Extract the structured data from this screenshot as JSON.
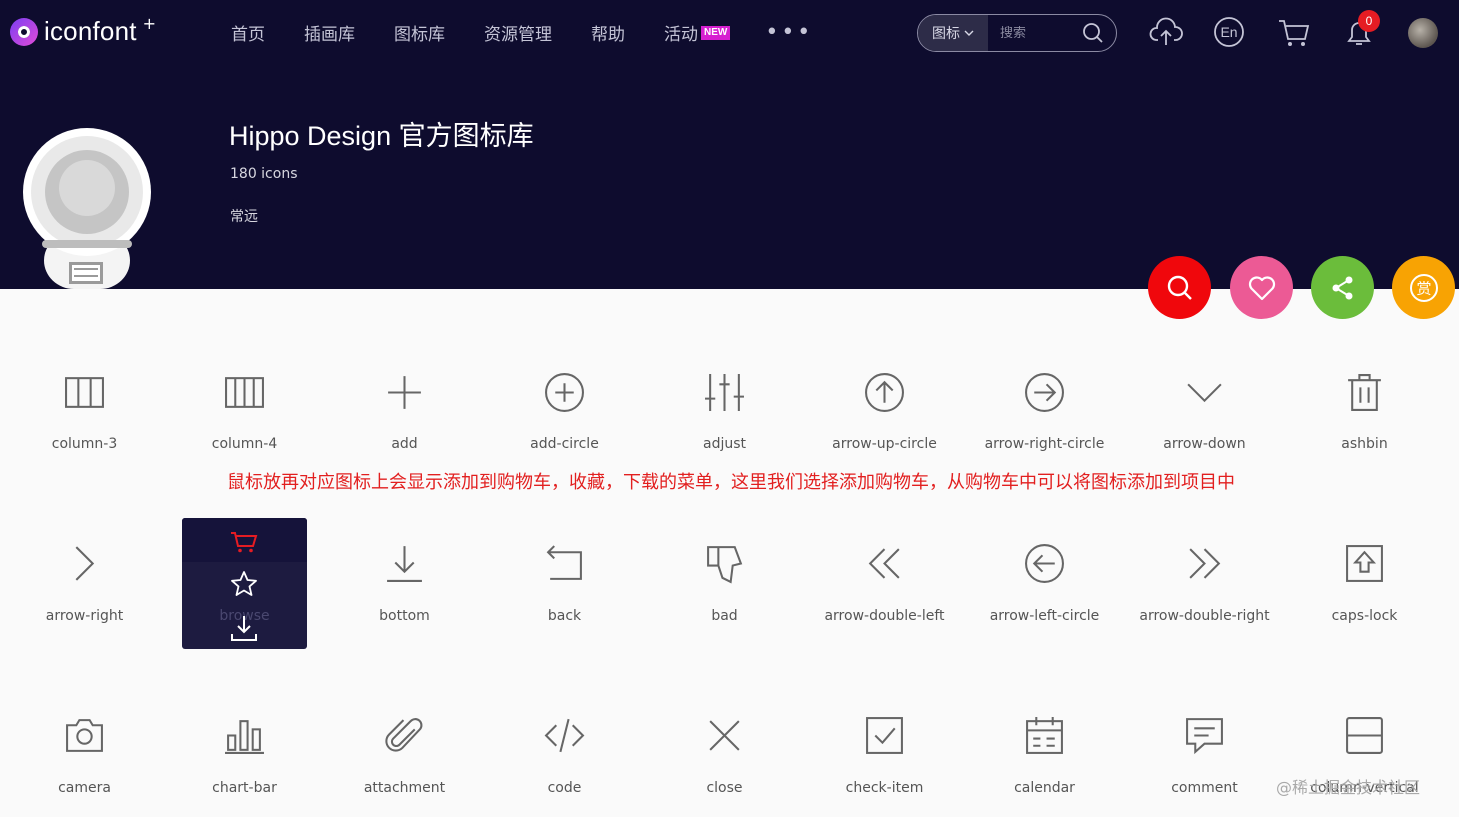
{
  "header": {
    "logo_text": "iconfont",
    "logo_sup": "+",
    "nav": [
      "首页",
      "插画库",
      "图标库",
      "资源管理",
      "帮助",
      "活动"
    ],
    "new_badge": "NEW",
    "more": "•••",
    "search": {
      "type": "图标",
      "placeholder": "搜索"
    },
    "notification_count": "0"
  },
  "library": {
    "title": "Hippo Design 官方图标库",
    "count": "180 icons",
    "author": "常远"
  },
  "actions": {
    "reward_label": "赏"
  },
  "icons": [
    {
      "label": "column-3",
      "icon": "column-3-icon"
    },
    {
      "label": "column-4",
      "icon": "column-4-icon"
    },
    {
      "label": "add",
      "icon": "add-icon"
    },
    {
      "label": "add-circle",
      "icon": "add-circle-icon"
    },
    {
      "label": "adjust",
      "icon": "adjust-icon"
    },
    {
      "label": "arrow-up-circle",
      "icon": "arrow-up-circle-icon"
    },
    {
      "label": "arrow-right-circle",
      "icon": "arrow-right-circle-icon"
    },
    {
      "label": "arrow-down",
      "icon": "arrow-down-icon"
    },
    {
      "label": "ashbin",
      "icon": "ashbin-icon"
    },
    {
      "label": "arrow-right",
      "icon": "arrow-right-icon"
    },
    {
      "label": "browse",
      "icon": "browse-icon"
    },
    {
      "label": "bottom",
      "icon": "bottom-icon"
    },
    {
      "label": "back",
      "icon": "back-icon"
    },
    {
      "label": "bad",
      "icon": "bad-icon"
    },
    {
      "label": "arrow-double-left",
      "icon": "arrow-double-left-icon"
    },
    {
      "label": "arrow-left-circle",
      "icon": "arrow-left-circle-icon"
    },
    {
      "label": "arrow-double-right",
      "icon": "arrow-double-right-icon"
    },
    {
      "label": "caps-lock",
      "icon": "caps-lock-icon"
    },
    {
      "label": "camera",
      "icon": "camera-icon"
    },
    {
      "label": "chart-bar",
      "icon": "chart-bar-icon"
    },
    {
      "label": "attachment",
      "icon": "attachment-icon"
    },
    {
      "label": "code",
      "icon": "code-icon"
    },
    {
      "label": "close",
      "icon": "close-icon"
    },
    {
      "label": "check-item",
      "icon": "check-item-icon"
    },
    {
      "label": "calendar",
      "icon": "calendar-icon"
    },
    {
      "label": "comment",
      "icon": "comment-icon"
    },
    {
      "label": "column-vertical",
      "icon": "column-vertical-icon"
    }
  ],
  "annotation": "鼠标放再对应图标上会显示添加到购物车，收藏，下载的菜单，这里我们选择添加购物车，从购物车中可以将图标添加到项目中",
  "watermark": "@稀土掘金技术社区",
  "colors": {
    "header_bg": "#0e0c2e",
    "search_fab": "#f0070c",
    "favorite_fab": "#ec5a95",
    "share_fab": "#6bbd3b",
    "reward_fab": "#f8a303",
    "annotation": "#e21f1f",
    "cart_active": "#e51c23"
  }
}
